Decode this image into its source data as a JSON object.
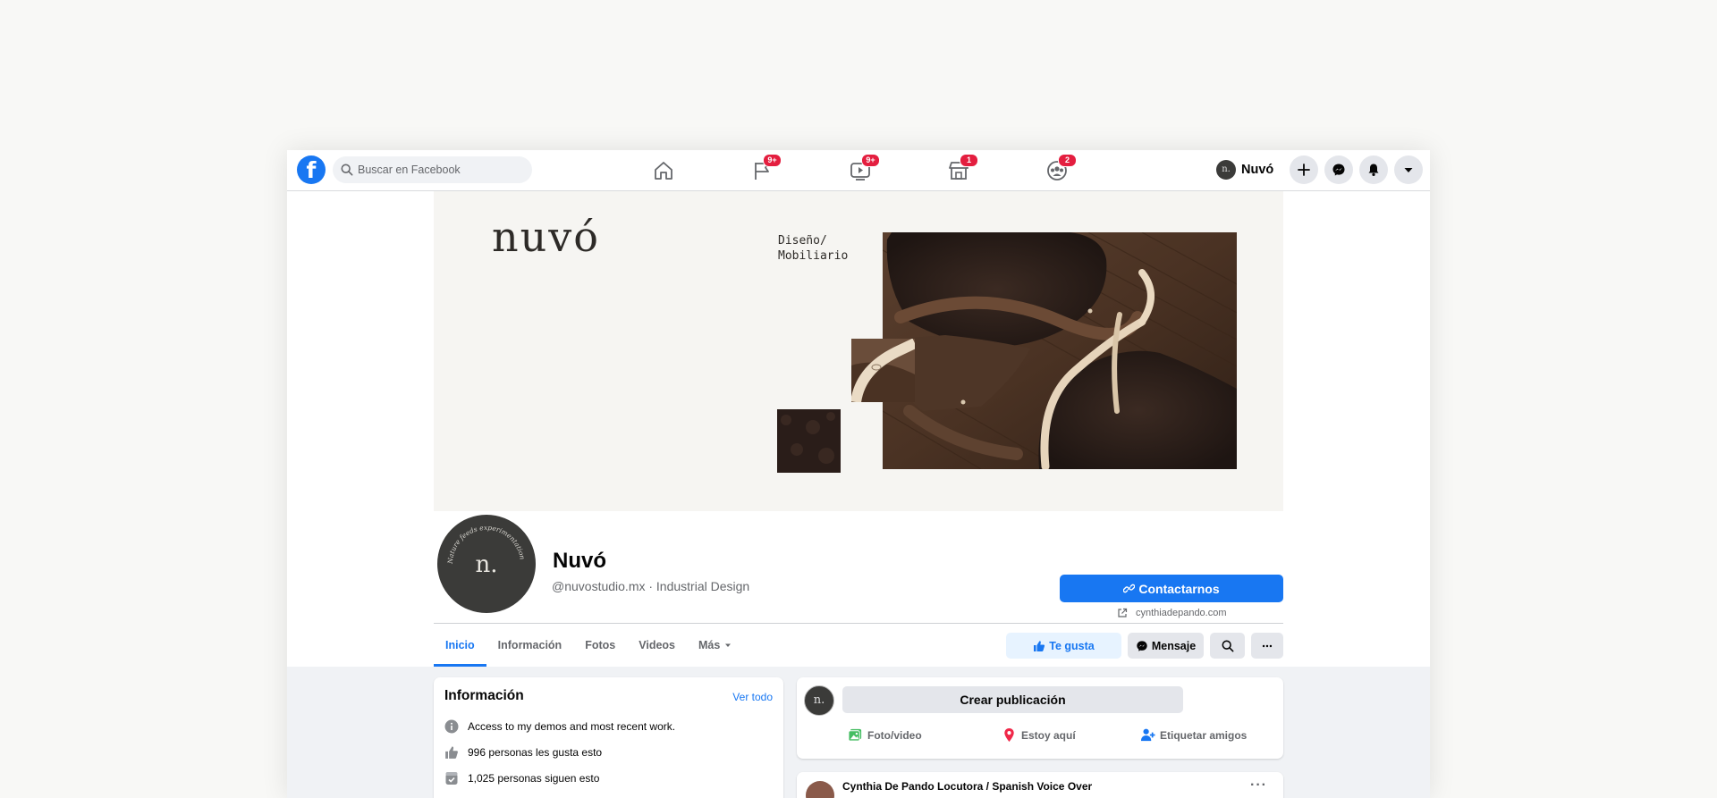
{
  "topbar": {
    "logo": "f",
    "search_placeholder": "Buscar en Facebook",
    "nav": [
      {
        "icon": "home-icon",
        "badge": ""
      },
      {
        "icon": "flag-icon",
        "badge": "9+"
      },
      {
        "icon": "video-icon",
        "badge": "9+"
      },
      {
        "icon": "marketplace-icon",
        "badge": "1"
      },
      {
        "icon": "groups-icon",
        "badge": "2"
      }
    ],
    "profile_name": "Nuvó",
    "profile_initial": "n.",
    "right_icons": [
      "plus-icon",
      "messenger-icon",
      "bell-icon",
      "caret-down-icon"
    ]
  },
  "cover": {
    "logo_text": "nuvó",
    "text_line1": "Diseño/",
    "text_line2": "Mobiliario"
  },
  "profile": {
    "avatar_text": "n.",
    "avatar_ring_text": "Nature feeds experimentation",
    "name": "Nuvó",
    "handle": "@nuvostudio.mx · Industrial Design",
    "contact_label": "Contactarnos",
    "website": "cynthiadepando.com"
  },
  "tabs": [
    {
      "label": "Inicio",
      "active": true
    },
    {
      "label": "Información",
      "active": false
    },
    {
      "label": "Fotos",
      "active": false
    },
    {
      "label": "Videos",
      "active": false
    },
    {
      "label": "Más",
      "active": false
    }
  ],
  "actions": {
    "like_label": "Te gusta",
    "message_label": "Mensaje"
  },
  "info_card": {
    "title": "Información",
    "see_all": "Ver todo",
    "rows": [
      {
        "icon": "info-icon",
        "text": "Access to my demos and most recent work."
      },
      {
        "icon": "thumbs-up-icon",
        "text": "996 personas les gusta esto"
      },
      {
        "icon": "follow-icon",
        "text": "1,025 personas siguen esto"
      }
    ]
  },
  "create_post": {
    "avatar_text": "n.",
    "label": "Crear publicación",
    "photo_label": "Foto/video",
    "checkin_label": "Estoy aquí",
    "tag_label": "Etiquetar amigos"
  },
  "post": {
    "author": "Cynthia De Pando Locutora / Spanish Voice Over",
    "more": "···"
  },
  "colors": {
    "accent": "#1877f2",
    "badge": "#e41e3f",
    "feed_bg": "#f0f2f5",
    "cover_bg": "#f6f5f2"
  }
}
